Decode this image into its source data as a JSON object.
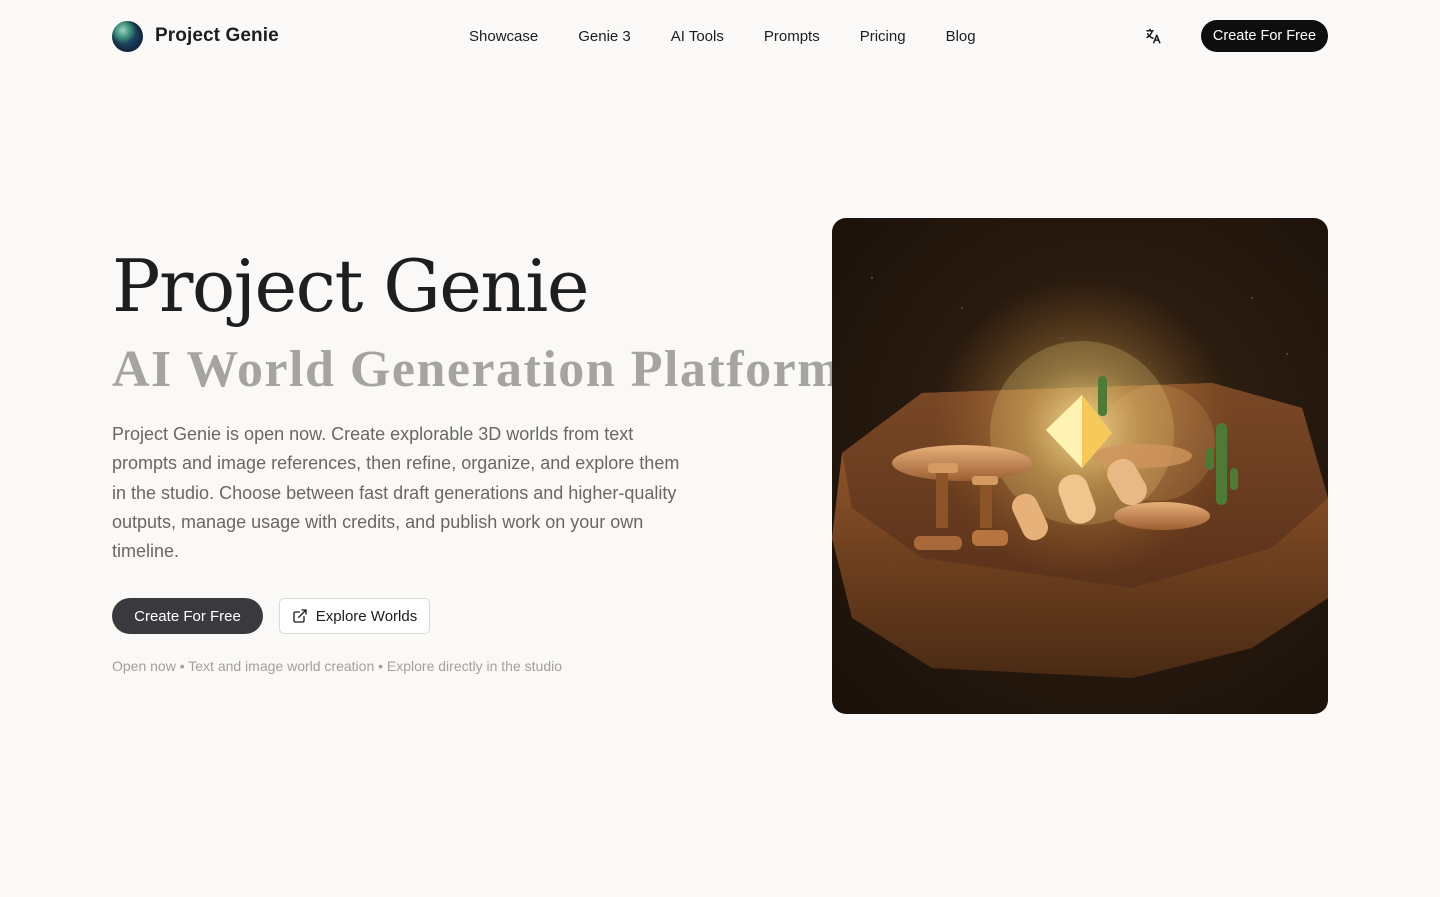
{
  "header": {
    "brand_name": "Project Genie",
    "nav": [
      {
        "label": "Showcase"
      },
      {
        "label": "Genie 3"
      },
      {
        "label": "AI Tools"
      },
      {
        "label": "Prompts"
      },
      {
        "label": "Pricing"
      },
      {
        "label": "Blog"
      }
    ],
    "language_icon": "translate-icon",
    "cta_label": "Create For Free"
  },
  "hero": {
    "title": "Project Genie",
    "subtitle": "AI World Generation Platform",
    "description": "Project Genie is open now. Create explorable 3D worlds from text prompts and image references, then refine, organize, and explore them in the studio. Choose between fast draft generations and higher-quality outputs, manage usage with credits, and publish work on your own timeline.",
    "primary_button": "Create For Free",
    "secondary_button": "Explore Worlds",
    "secondary_icon": "external-link-icon",
    "tagline": "Open now • Text and image world creation • Explore directly in the studio"
  },
  "scene": {
    "image_alt": "3D desert island world with glowing crystal",
    "colors": {
      "ground": "#8a4f2a",
      "crystal": "#ffe27a",
      "cactus": "#4f7a35"
    }
  }
}
